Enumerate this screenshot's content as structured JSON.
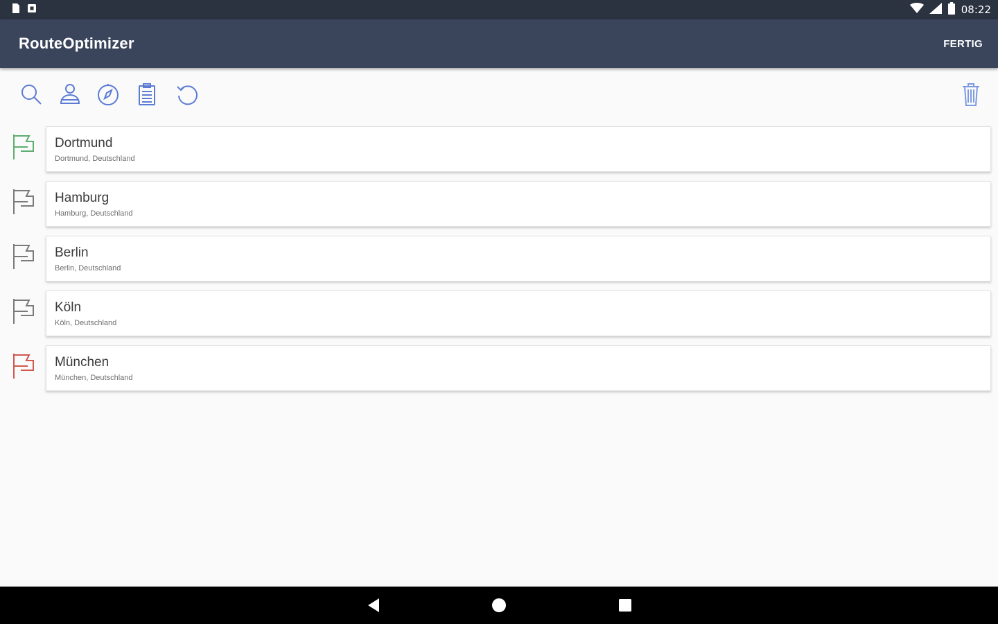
{
  "status_bar": {
    "time": "08:22",
    "left_icons": [
      "sd-card-icon",
      "notification-icon"
    ],
    "right_icons": [
      "wifi-icon",
      "signal-icon",
      "battery-icon"
    ]
  },
  "app_bar": {
    "title": "RouteOptimizer",
    "done_label": "FERTIG"
  },
  "toolbar": {
    "icons": [
      "search-icon",
      "contact-icon",
      "compass-icon",
      "clipboard-icon",
      "undo-icon",
      "trash-icon"
    ],
    "accent_color": "#5b7bd5"
  },
  "stops": [
    {
      "name": "Dortmund",
      "address": "Dortmund, Deutschland",
      "flag_color": "#5fae6f",
      "flag_role": "start"
    },
    {
      "name": "Hamburg",
      "address": "Hamburg, Deutschland",
      "flag_color": "#7a7a7a",
      "flag_role": "stop"
    },
    {
      "name": "Berlin",
      "address": "Berlin, Deutschland",
      "flag_color": "#7a7a7a",
      "flag_role": "stop"
    },
    {
      "name": "Köln",
      "address": "Köln, Deutschland",
      "flag_color": "#7a7a7a",
      "flag_role": "stop"
    },
    {
      "name": "München",
      "address": "München, Deutschland",
      "flag_color": "#d0584f",
      "flag_role": "end"
    }
  ],
  "nav_bar": {
    "buttons": [
      "back-button",
      "home-button",
      "recents-button"
    ]
  }
}
